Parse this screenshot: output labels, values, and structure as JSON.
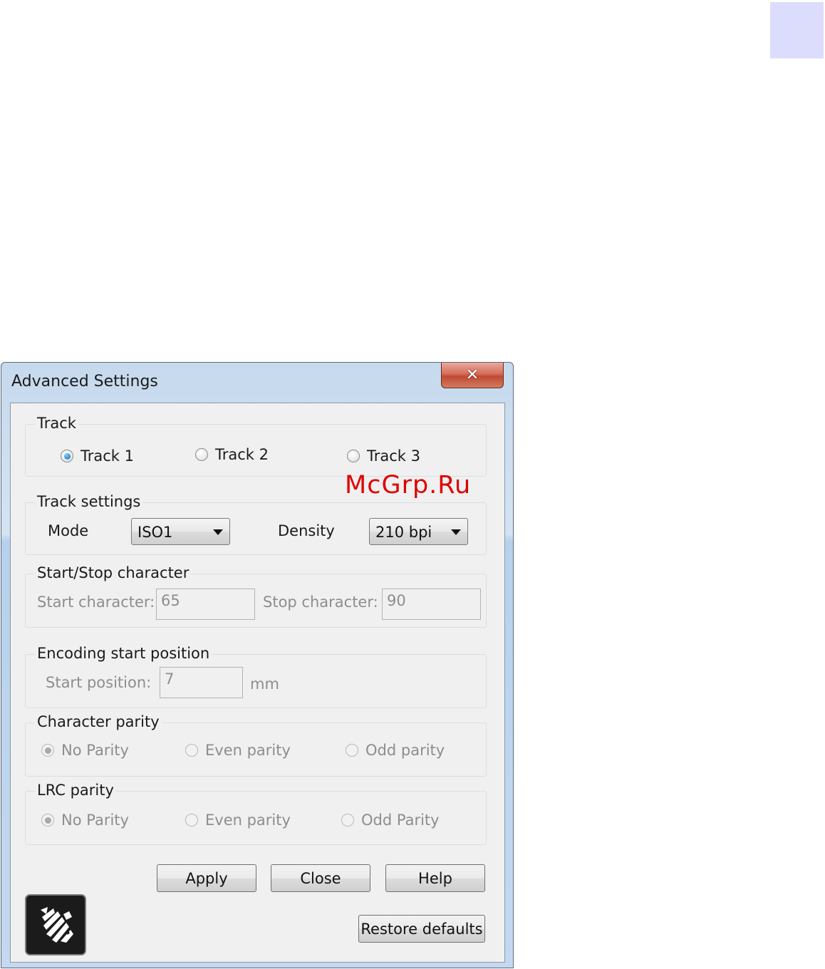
{
  "window": {
    "title": "Advanced Settings",
    "close_glyph": "✕"
  },
  "track": {
    "label": "Track",
    "options": [
      {
        "label": "Track 1",
        "selected": true
      },
      {
        "label": "Track 2",
        "selected": false
      },
      {
        "label": "Track 3",
        "selected": false
      }
    ]
  },
  "track_settings": {
    "label": "Track settings",
    "mode_label": "Mode",
    "mode_value": "ISO1",
    "density_label": "Density",
    "density_value": "210 bpi"
  },
  "start_stop": {
    "label": "Start/Stop character",
    "start_label": "Start character:",
    "start_value": "65",
    "stop_label": "Stop character:",
    "stop_value": "90"
  },
  "encoding": {
    "label": "Encoding start position",
    "start_label": "Start position:",
    "start_value": "7",
    "unit": "mm"
  },
  "char_parity": {
    "label": "Character parity",
    "options": [
      {
        "label": "No Parity",
        "selected": true
      },
      {
        "label": "Even parity",
        "selected": false
      },
      {
        "label": "Odd parity",
        "selected": false
      }
    ]
  },
  "lrc_parity": {
    "label": "LRC parity",
    "options": [
      {
        "label": "No Parity",
        "selected": true
      },
      {
        "label": "Even parity",
        "selected": false
      },
      {
        "label": "Odd Parity",
        "selected": false
      }
    ]
  },
  "buttons": {
    "apply": "Apply",
    "close": "Close",
    "help": "Help",
    "restore": "Restore defaults"
  },
  "logo": {
    "icon": "zebra-logo-icon"
  },
  "watermark": "McGrp.Ru",
  "colors": {
    "page_tab": "#dcdcfc",
    "watermark": "#e00000",
    "radio_selected": "#1565b8"
  }
}
